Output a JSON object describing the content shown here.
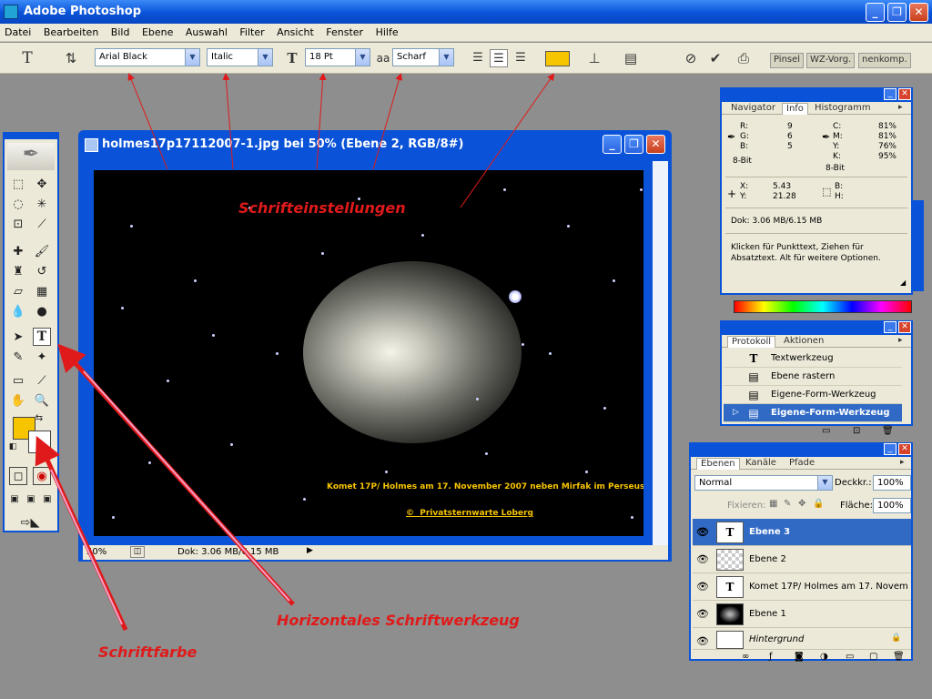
{
  "window": {
    "title": "Adobe Photoshop",
    "controls": {
      "minimize": "_",
      "maximize": "❐",
      "close": "✕"
    }
  },
  "menu": [
    "Datei",
    "Bearbeiten",
    "Bild",
    "Ebene",
    "Auswahl",
    "Filter",
    "Ansicht",
    "Fenster",
    "Hilfe"
  ],
  "options_bar": {
    "font_family": "Arial Black",
    "font_style": "Italic",
    "font_size": "18 Pt",
    "antialias_label": "aa",
    "antialias": "Scharf",
    "text_color": "#f7c500",
    "well_tabs": [
      "Pinsel",
      "WZ-Vorg.",
      "nenkomp."
    ]
  },
  "document": {
    "title": "holmes17p17112007-1.jpg bei 50% (Ebene 2, RGB/8#)",
    "zoom": "50%",
    "doc_info": "Dok: 3.06 MB/6.15 MB",
    "caption": "Komet 17P/ Holmes am 17. November 2007 neben Mirfak im Perseus",
    "copyright_symbol": "©",
    "copyright": "Privatsternwarte Loberg"
  },
  "info_panel": {
    "tabs": [
      "Navigator",
      "Info",
      "Histogramm"
    ],
    "active_tab": "Info",
    "rgb": {
      "R": "9",
      "G": "6",
      "B": "5"
    },
    "rgb_mode": "8-Bit",
    "cmyk": {
      "C": "81%",
      "M": "81%",
      "Y": "76%",
      "K": "95%"
    },
    "cmyk_mode": "8-Bit",
    "xy": {
      "X": "5.43",
      "Y": "21.28"
    },
    "bh": {
      "B": "",
      "H": ""
    },
    "doc_info": "Dok: 3.06 MB/6.15 MB",
    "hint": "Klicken für Punkttext, Ziehen für Absatztext. Alt für weitere Optionen."
  },
  "history_panel": {
    "tabs": [
      "Protokoll",
      "Aktionen"
    ],
    "items": [
      {
        "icon": "T",
        "label": "Textwerkzeug"
      },
      {
        "icon": "▤",
        "label": "Ebene rastern"
      },
      {
        "icon": "▤",
        "label": "Eigene-Form-Werkzeug"
      },
      {
        "icon": "▤",
        "label": "Eigene-Form-Werkzeug"
      }
    ]
  },
  "layers_panel": {
    "tabs": [
      "Ebenen",
      "Kanäle",
      "Pfade"
    ],
    "blend_mode": "Normal",
    "opacity_label": "Deckkr.:",
    "opacity": "100%",
    "lock_label": "Fixieren:",
    "fill_label": "Fläche:",
    "fill": "100%",
    "layers": [
      {
        "name": "Ebene 3",
        "thumb": "T"
      },
      {
        "name": "Ebene 2",
        "thumb": ""
      },
      {
        "name": "Komet 17P/ Holmes am 17. Novem",
        "thumb": "T"
      },
      {
        "name": "Ebene 1",
        "thumb": ""
      },
      {
        "name": "Hintergrund",
        "thumb": ""
      }
    ]
  },
  "annotations": {
    "font_settings": "Schrifteinstellungen",
    "type_tool": "Horizontales Schriftwerkzeug",
    "font_color": "Schriftfarbe"
  },
  "colors": {
    "accent_red": "#e01a1a",
    "foreground": "#f7c500",
    "background": "#ffffff"
  }
}
